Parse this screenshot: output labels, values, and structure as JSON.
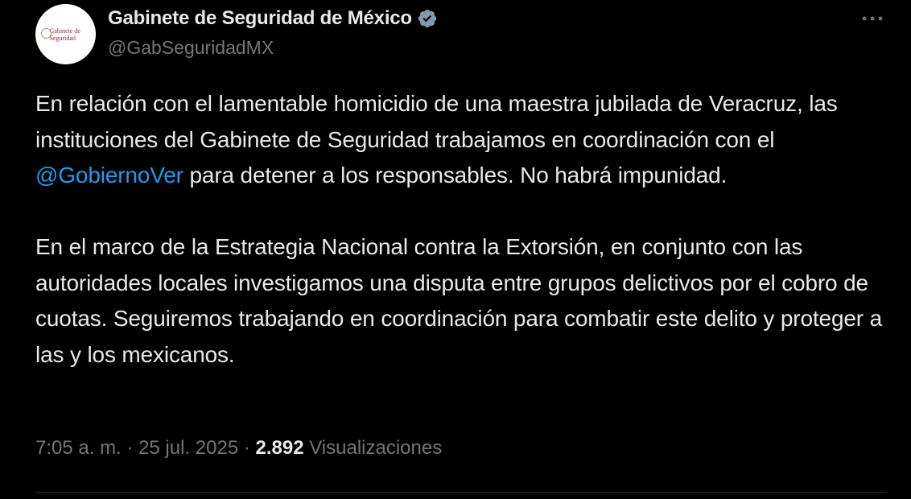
{
  "author": {
    "avatar_text": "Gabinete de Seguridad",
    "display_name": "Gabinete de Seguridad de México",
    "handle": "@GabSeguridadMX",
    "verified_icon": "verified-badge-icon",
    "more_icon": "more-options-icon"
  },
  "tweet": {
    "paragraph_1_part_1": "En relación con el lamentable homicidio de una maestra jubilada de Veracruz, las instituciones del Gabinete de Seguridad trabajamos en coordinación con el ",
    "mention": "@GobiernoVer",
    "paragraph_1_part_2": " para detener a los responsables. No habrá impunidad.",
    "paragraph_2": "En el marco de la Estrategia Nacional contra la Extorsión, en conjunto con las autoridades locales investigamos una disputa entre grupos delictivos por el cobro de cuotas. Seguiremos trabajando en coordinación para combatir este delito y proteger a las y los mexicanos."
  },
  "meta": {
    "time": "7:05 a. m.",
    "separator": " · ",
    "date": "25 jul. 2025",
    "views_count": "2.892",
    "views_label": "Visualizaciones"
  },
  "colors": {
    "background": "#000000",
    "text": "#e7e9ea",
    "secondary": "#71767b",
    "link": "#1d9bf0",
    "verified": "#829aab"
  }
}
